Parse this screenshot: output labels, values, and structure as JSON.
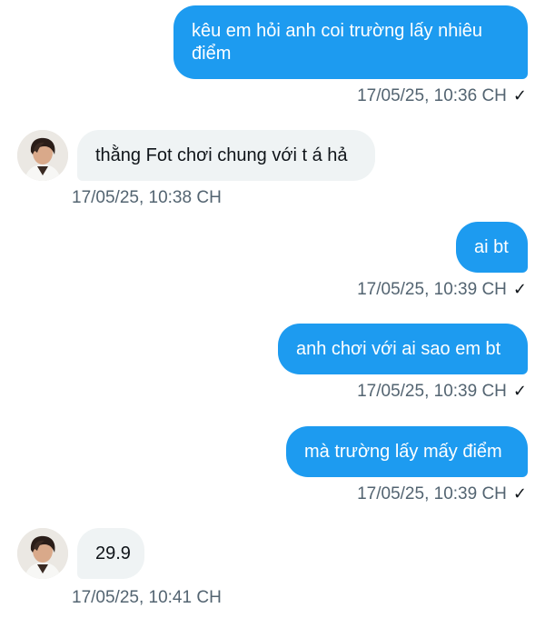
{
  "messages": [
    {
      "direction": "out",
      "text": "kêu em hỏi anh coi trường lấy nhiêu điểm",
      "timestamp": "17/05/25, 10:36 CH",
      "status_icon": "check-icon"
    },
    {
      "direction": "in",
      "text": "thằng Fot chơi chung với t á hả",
      "timestamp": "17/05/25, 10:38 CH",
      "avatar_icon": "user-avatar"
    },
    {
      "direction": "out",
      "text": "ai bt",
      "timestamp": "17/05/25, 10:39 CH",
      "status_icon": "check-icon"
    },
    {
      "direction": "out",
      "text": "anh chơi với ai sao em bt",
      "timestamp": "17/05/25, 10:39 CH",
      "status_icon": "check-icon"
    },
    {
      "direction": "out",
      "text": "mà trường lấy mấy điểm",
      "timestamp": "17/05/25, 10:39 CH",
      "status_icon": "check-icon"
    },
    {
      "direction": "in",
      "text": "29.9",
      "timestamp": "17/05/25, 10:41 CH",
      "avatar_icon": "user-avatar"
    }
  ],
  "check_glyph": "✓",
  "colors": {
    "outgoing_bubble": "#1d9bf0",
    "incoming_bubble": "#eff3f4",
    "timestamp_text": "#536471"
  }
}
